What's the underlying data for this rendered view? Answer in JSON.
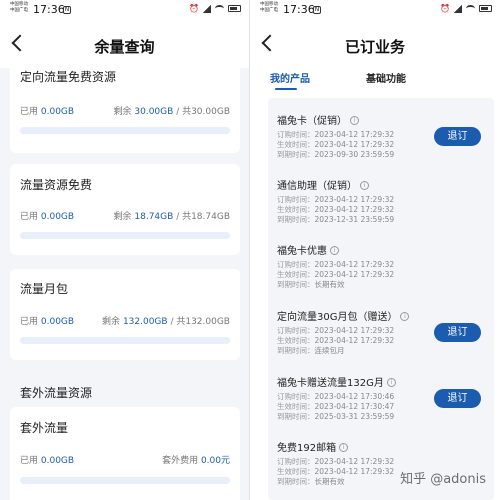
{
  "left": {
    "status": {
      "carrier_line1": "中国移动",
      "carrier_line2": "中国广电",
      "time": "17:36",
      "badge": "N"
    },
    "nav": {
      "title": "余量查询"
    },
    "sections": [
      {
        "title": "定向流量免费资源",
        "used_label": "已用",
        "used": "0.00GB",
        "remaining_label": "剩余",
        "remaining": "30.00GB",
        "total": "/ 共30.00GB",
        "used_fraction": 0
      },
      {
        "title": "流量资源免费",
        "used_label": "已用",
        "used": "0.00GB",
        "remaining_label": "剩余",
        "remaining": "18.74GB",
        "total": "/ 共18.74GB",
        "used_fraction": 0
      },
      {
        "title": "流量月包",
        "used_label": "已用",
        "used": "0.00GB",
        "remaining_label": "剩余",
        "remaining": "132.00GB",
        "total": "/ 共132.00GB",
        "used_fraction": 0
      }
    ],
    "extra_section_title": "套外流量资源",
    "extra_card": {
      "title": "套外流量",
      "used_label": "已用",
      "used": "0.00GB",
      "fee_label": "套外费用",
      "fee": "0.00元"
    }
  },
  "right": {
    "status": {
      "carrier_line1": "中国移动",
      "carrier_line2": "中国广电",
      "time": "17:36",
      "badge": "N"
    },
    "nav": {
      "title": "已订业务"
    },
    "tabs": [
      {
        "label": "我的产品",
        "active": true
      },
      {
        "label": "基础功能",
        "active": false
      }
    ],
    "labels": {
      "order": "订购时间：",
      "effective": "生效时间：",
      "expire": "到期时间："
    },
    "products": [
      {
        "name": "福兔卡（促销）",
        "order": "2023-04-12 17:29:32",
        "effective": "2023-04-12 17:29:32",
        "expire": "2023-09-30 23:59:59",
        "action": "退订"
      },
      {
        "name": "通信助理（促销）",
        "order": "2023-04-12 17:29:32",
        "effective": "2023-04-12 17:29:32",
        "expire": "2023-12-31 23:59:59",
        "action": ""
      },
      {
        "name": "福兔卡优惠",
        "order": "2023-04-12 17:29:32",
        "effective": "2023-04-12 17:29:32",
        "expire": "长期有效",
        "action": ""
      },
      {
        "name": "定向流量30G月包（赠送）",
        "order": "2023-04-12 17:29:32",
        "effective": "2023-04-12 17:29:32",
        "expire": "连续包月",
        "action": "退订"
      },
      {
        "name": "福兔卡赠送流量132G月",
        "order": "2023-04-12 17:30:46",
        "effective": "2023-04-12 17:30:47",
        "expire": "2025-03-31 23:59:59",
        "action": "退订"
      },
      {
        "name": "免费192邮箱",
        "order": "2023-04-12 17:29:32",
        "effective": "2023-04-12 17:29:32",
        "expire": "长期有效",
        "action": ""
      }
    ],
    "watermark": "知乎 @adonis"
  }
}
